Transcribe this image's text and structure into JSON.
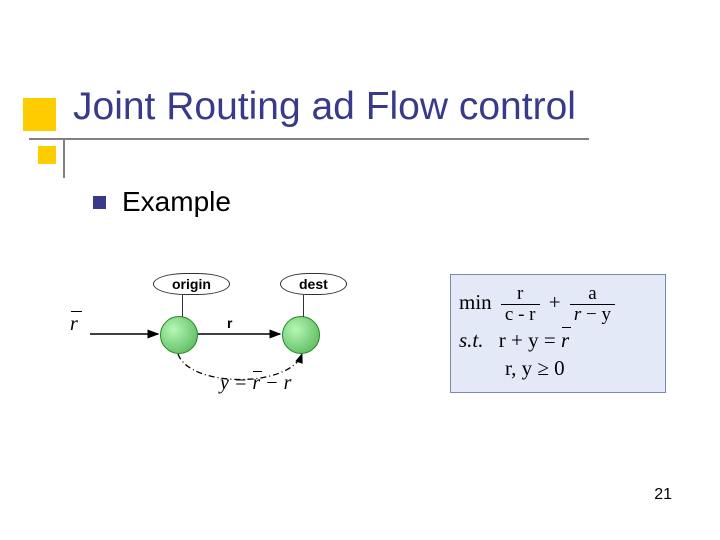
{
  "title": "Joint Routing ad Flow control",
  "bullet": "Example",
  "diagram": {
    "origin_label": "origin",
    "dest_label": "dest",
    "r_bar": "r",
    "r_edge": "r",
    "y_equation_prefix": "y = ",
    "y_equation_suffix": " − r"
  },
  "formula": {
    "min": "min",
    "frac1_num": "r",
    "frac1_den": "c - r",
    "plus": "+",
    "frac2_num": "a",
    "frac2_den_suffix": " − y",
    "st": "s.t.",
    "constraint1_prefix": "r + y = ",
    "constraint2": "r, y ≥ 0"
  },
  "page_number": "21"
}
